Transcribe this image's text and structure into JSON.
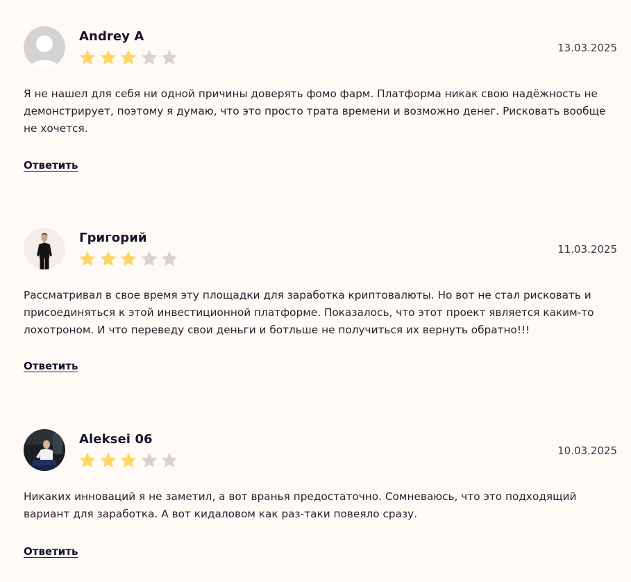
{
  "reviews": [
    {
      "author": "Andrey A",
      "date": "13.03.2025",
      "rating": 3,
      "rating_max": 5,
      "text": "Я не нашел для себя ни одной причины доверять фомо фарм. Платформа никак свою надёжность не демонстрирует, поэтому я думаю, что это просто трата времени и возможно денег. Рисковать вообще не хочется.",
      "reply_label": "Ответить",
      "avatar": "default-user-avatar"
    },
    {
      "author": "Григорий",
      "date": "11.03.2025",
      "rating": 3,
      "rating_max": 5,
      "text": "Рассматривал в свое время эту площадки для заработка криптовалюты. Но вот не стал рисковать и присоединяться к этой инвестиционной платформе. Показалось, что этот проект является каким-то лохотроном. И что переведу свои деньги и ботльше не получиться их вернуть обратно!!!",
      "reply_label": "Ответить",
      "avatar": "photo-man-black-shirt"
    },
    {
      "author": "Aleksei 06",
      "date": "10.03.2025",
      "rating": 3,
      "rating_max": 5,
      "text": "Никаких инноваций я не заметил, а вот вранья предостаточно. Сомневаюсь, что это подходящий вариант для заработка. А вот кидаловом как раз-таки повеяло сразу.",
      "reply_label": "Ответить",
      "avatar": "photo-man-sitting"
    }
  ],
  "colors": {
    "background": "#fffaf6",
    "star_filled": "#fdd663",
    "star_empty": "#d4d4d4",
    "text": "#23232f",
    "heading": "#14142b"
  }
}
